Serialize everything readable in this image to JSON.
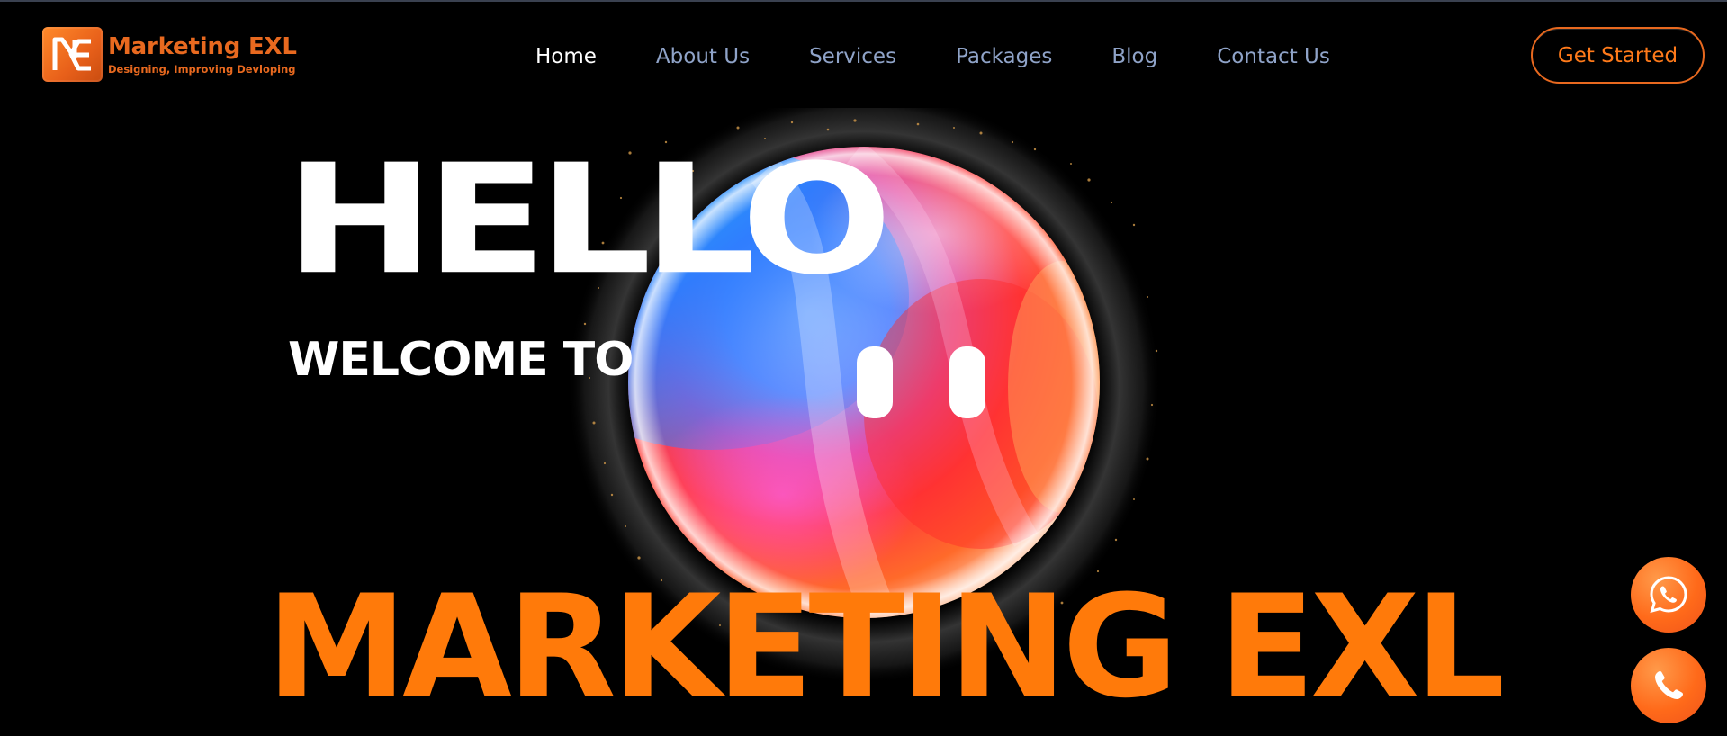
{
  "header": {
    "logo_title": "Marketing EXL",
    "logo_tagline": "Designing, Improving Devloping",
    "nav": [
      {
        "label": "Home",
        "active": true
      },
      {
        "label": "About Us",
        "active": false
      },
      {
        "label": "Services",
        "active": false
      },
      {
        "label": "Packages",
        "active": false
      },
      {
        "label": "Blog",
        "active": false
      },
      {
        "label": "Contact Us",
        "active": false
      }
    ],
    "cta_label": "Get Started"
  },
  "hero": {
    "hello": "HELLO",
    "welcome": "WELCOME TO",
    "brand": "MARKETING EXL"
  },
  "floating_buttons": [
    {
      "icon": "whatsapp-icon"
    },
    {
      "icon": "phone-icon"
    }
  ],
  "colors": {
    "accent": "#ff7a0a",
    "nav_text": "#8fa3c8",
    "nav_active": "#ffffff",
    "background": "#000000"
  }
}
